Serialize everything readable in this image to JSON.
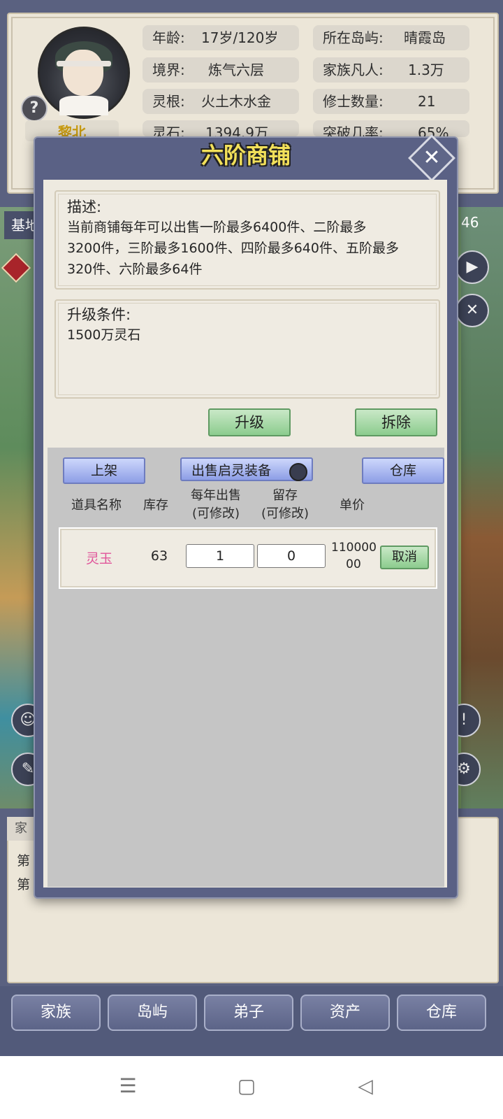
{
  "profile": {
    "name": "黎北",
    "stats_left": [
      {
        "key": "年龄:",
        "value": "17岁/120岁"
      },
      {
        "key": "境界:",
        "value": "炼气六层"
      },
      {
        "key": "灵根:",
        "value": "火土木水金"
      },
      {
        "key": "灵石:",
        "value": "1394.9万"
      }
    ],
    "stats_right": [
      {
        "key": "所在岛屿:",
        "value": "晴霞岛"
      },
      {
        "key": "家族凡人:",
        "value": "1.3万"
      },
      {
        "key": "修士数量:",
        "value": "21"
      },
      {
        "key": "突破几率:",
        "value": "65%"
      }
    ]
  },
  "map": {
    "base_label": "基地",
    "count_label": "46"
  },
  "log": {
    "tab_label": "家",
    "lines": [
      "第",
      "第"
    ]
  },
  "modal": {
    "title": "六阶商铺",
    "desc_header": "描述:",
    "desc_lines": [
      "当前商铺每年可以出售一阶最多6400件、二阶最多",
      "3200件，三阶最多1600件、四阶最多640件、五阶最多",
      "320件、六阶最多64件"
    ],
    "upgrade_header": "升级条件:",
    "upgrade_text": "1500万灵石",
    "upgrade_button": "升级",
    "demolish_button": "拆除",
    "list_button": "上架",
    "sell_toggle_label": "出售启灵装备",
    "warehouse_button": "仓库",
    "table_headers": {
      "name": "道具名称",
      "stock": "库存",
      "yearly_line1": "每年出售",
      "yearly_line2": "(可修改)",
      "reserve_line1": "留存",
      "reserve_line2": "(可修改)",
      "price": "单价"
    },
    "items": [
      {
        "name": "灵玉",
        "stock": "63",
        "yearly": "1",
        "reserve": "0",
        "price_line1": "110000",
        "price_line2": "00",
        "cancel": "取消"
      }
    ]
  },
  "bottom_nav": [
    "家族",
    "岛屿",
    "弟子",
    "资产",
    "仓库"
  ],
  "colors": {
    "title_yellow": "#f2e05a",
    "item_pink": "#e0559a",
    "name_gold": "#c79a10",
    "green_button": "#8ccc8e",
    "blue_button": "#8d9ee6"
  }
}
